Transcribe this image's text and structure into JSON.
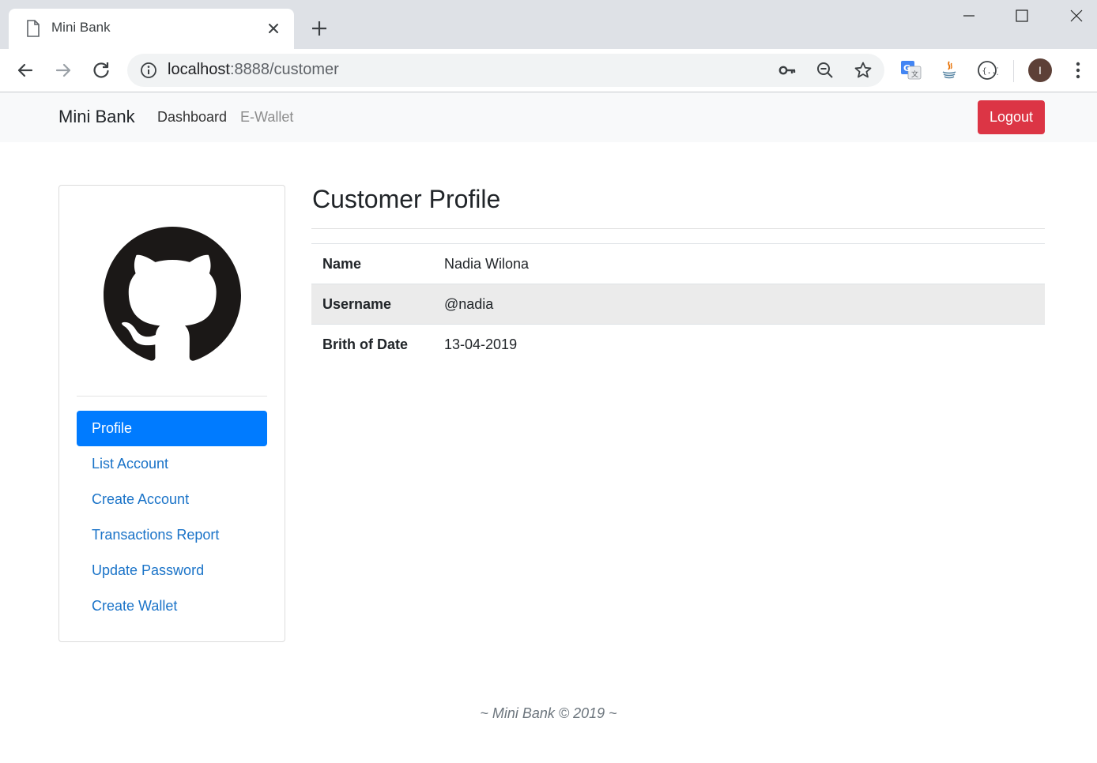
{
  "browser": {
    "tab_title": "Mini Bank",
    "url_host": "localhost",
    "url_rest": ":8888/customer",
    "profile_initial": "I"
  },
  "navbar": {
    "brand": "Mini Bank",
    "links": [
      "Dashboard",
      "E-Wallet"
    ],
    "logout_label": "Logout"
  },
  "sidebar": {
    "items": [
      {
        "label": "Profile",
        "active": true
      },
      {
        "label": "List Account"
      },
      {
        "label": "Create Account"
      },
      {
        "label": "Transactions Report"
      },
      {
        "label": "Update Password"
      },
      {
        "label": "Create Wallet"
      }
    ]
  },
  "main": {
    "title": "Customer Profile",
    "rows": [
      {
        "label": "Name",
        "value": "Nadia Wilona"
      },
      {
        "label": "Username",
        "value": "@nadia"
      },
      {
        "label": "Brith of Date",
        "value": "13-04-2019"
      }
    ]
  },
  "footer": "~ Mini Bank © 2019 ~",
  "colors": {
    "primary": "#007bff",
    "danger": "#dc3545",
    "navbar_bg": "#f8f9fa"
  }
}
